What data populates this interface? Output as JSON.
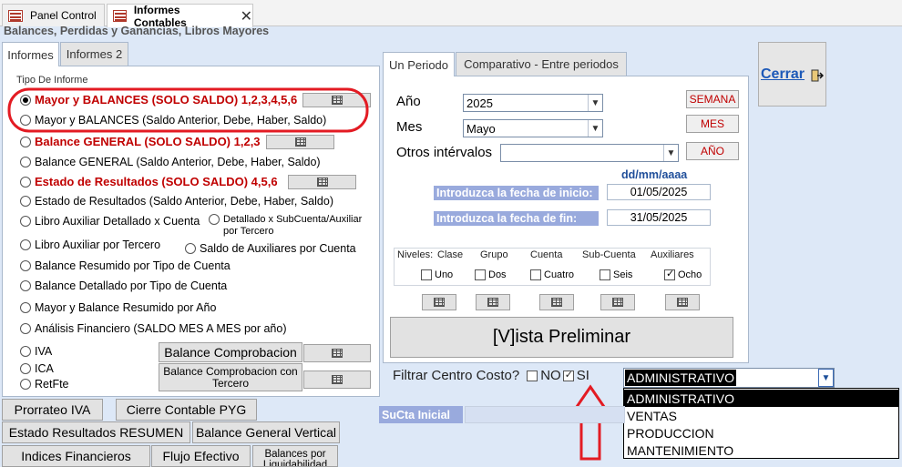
{
  "window": {
    "tabs": [
      {
        "label": "Panel Control"
      },
      {
        "label": "Informes Contables"
      }
    ],
    "subtitle": "Balances, Perdidas y Ganancias, Libros Mayores"
  },
  "left_tabs": [
    {
      "label": "Informes"
    },
    {
      "label": "Informes 2"
    }
  ],
  "tipo_label": "Tipo De Informe",
  "options": [
    {
      "label": "Mayor y BALANCES (SOLO SALDO) 1,2,3,4,5,6",
      "selected": true
    },
    {
      "label": "Mayor y BALANCES (Saldo Anterior, Debe, Haber, Saldo)"
    },
    {
      "label": "Balance GENERAL (SOLO SALDO) 1,2,3"
    },
    {
      "label": "Balance GENERAL (Saldo Anterior, Debe, Haber, Saldo)"
    },
    {
      "label": "Estado de Resultados (SOLO SALDO) 4,5,6"
    },
    {
      "label": "Estado de Resultados (Saldo Anterior, Debe, Haber, Saldo)"
    },
    {
      "label": "Libro Auxiliar Detallado x Cuenta"
    },
    {
      "label": "Detallado x SubCuenta/Auxiliar",
      "label2": "por Tercero"
    },
    {
      "label": "Libro Auxiliar por Tercero"
    },
    {
      "label": "Saldo de Auxiliares por Cuenta"
    },
    {
      "label": "Balance Resumido por Tipo de Cuenta"
    },
    {
      "label": "Balance Detallado por Tipo de Cuenta"
    },
    {
      "label": "Mayor y Balance Resumido por Año"
    },
    {
      "label": "Análisis Financiero (SALDO MES A MES por año)"
    },
    {
      "label": "IVA"
    },
    {
      "label": "ICA"
    },
    {
      "label": "RetFte"
    }
  ],
  "buttons": {
    "balance_comprobacion": "Balance Comprobacion",
    "balance_comprobacion_tercero": "Balance Comprobacion con Tercero",
    "semana": "SEMANA",
    "mes": "MES",
    "anio": "AÑO",
    "vista_preliminar": "[V]ista Preliminar",
    "cerrar": "Cerrar"
  },
  "period_tabs": [
    {
      "label": "Un Periodo"
    },
    {
      "label": "Comparativo - Entre periodos"
    }
  ],
  "period": {
    "anio_label": "Año",
    "anio_value": "2025",
    "mes_label": "Mes",
    "mes_value": "Mayo",
    "otros_label": "Otros intérvalos",
    "otros_value": "",
    "date_format": "dd/mm/aaaa",
    "fecha_inicio_label": "Introduzca la fecha de inicio:",
    "fecha_inicio": "01/05/2025",
    "fecha_fin_label": "Introduzca la fecha de fin:",
    "fecha_fin": "31/05/2025"
  },
  "niveles": {
    "title": "Niveles:",
    "columns": [
      {
        "header": "Clase",
        "label": "Uno",
        "checked": false
      },
      {
        "header": "Grupo",
        "label": "Dos",
        "checked": false
      },
      {
        "header": "Cuenta",
        "label": "Cuatro",
        "checked": false
      },
      {
        "header": "Sub-Cuenta",
        "label": "Seis",
        "checked": false
      },
      {
        "header": "Auxiliares",
        "label": "Ocho",
        "checked": true
      }
    ]
  },
  "filtro": {
    "label": "Filtrar Centro Costo?",
    "no_label": "NO",
    "si_label": "SI",
    "si_checked": true,
    "selected": "ADMINISTRATIVO",
    "options": [
      "ADMINISTRATIVO",
      "VENTAS",
      "PRODUCCION",
      "MANTENIMIENTO"
    ]
  },
  "sucta_label": "SuCta Inicial",
  "bottom_buttons": {
    "prorrateo_iva": "Prorrateo IVA",
    "cierre_contable": "Cierre Contable PYG",
    "estado_resultados_resumen": "Estado Resultados RESUMEN",
    "balance_general_vertical": "Balance General Vertical",
    "indices_financieros": "Indices Financieros",
    "flujo_efectivo": "Flujo Efectivo",
    "balances_liquidabilidad": "Balances por Liquidabilidad"
  },
  "colors": {
    "accent_red": "#c00000",
    "date_label_bg": "#99aadd",
    "annotation_red": "#e31b23"
  }
}
